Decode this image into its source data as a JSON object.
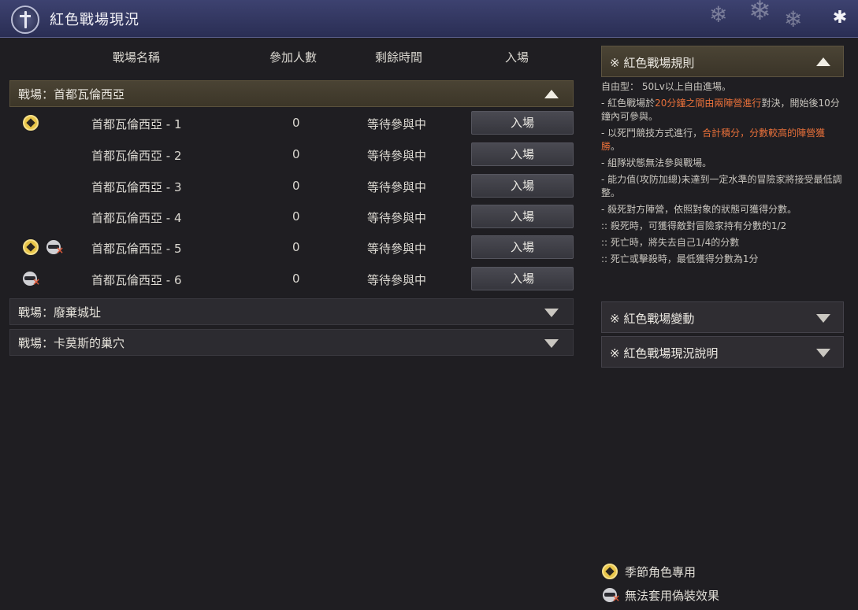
{
  "window": {
    "title": "紅色戰場現況"
  },
  "columns": {
    "name": "戰場名稱",
    "count": "參加人數",
    "time": "剩餘時間",
    "enter": "入場"
  },
  "groups": [
    {
      "label": "戰場：首都瓦倫西亞",
      "expanded": true
    },
    {
      "label": "戰場：廢棄城址",
      "expanded": false
    },
    {
      "label": "戰場：卡莫斯的巢穴",
      "expanded": false
    }
  ],
  "rows": [
    {
      "name": "首都瓦倫西亞 - 1",
      "count": "0",
      "status": "等待參與中",
      "button": "入場",
      "icons": [
        "season-icon"
      ]
    },
    {
      "name": "首都瓦倫西亞 - 2",
      "count": "0",
      "status": "等待參與中",
      "button": "入場",
      "icons": []
    },
    {
      "name": "首都瓦倫西亞 - 3",
      "count": "0",
      "status": "等待參與中",
      "button": "入場",
      "icons": []
    },
    {
      "name": "首都瓦倫西亞 - 4",
      "count": "0",
      "status": "等待參與中",
      "button": "入場",
      "icons": []
    },
    {
      "name": "首都瓦倫西亞 - 5",
      "count": "0",
      "status": "等待參與中",
      "button": "入場",
      "icons": [
        "season-icon",
        "no-disguise-icon"
      ]
    },
    {
      "name": "首都瓦倫西亞 - 6",
      "count": "0",
      "status": "等待參與中",
      "button": "入場",
      "icons": [
        "no-disguise-icon"
      ]
    }
  ],
  "rules": {
    "header": "※ 紅色戰場規則",
    "free_type": "自由型： 50Lv以上自由進場。",
    "line1_pre": "- 紅色戰場於",
    "line1_hl": "20分鐘之間由兩陣營進行",
    "line1_post": "對決，開始後10分鐘內可參與。",
    "line2_pre": "- 以死鬥競技方式進行，",
    "line2_hl": "合計積分，分數較高的陣營獲勝",
    "line2_post": "。",
    "line3": "- 組隊狀態無法參與戰場。",
    "line4": "- 能力值(攻防加總)未達到一定水準的冒險家將接受最低調整。",
    "line5": "- 殺死對方陣營，依照對象的狀態可獲得分數。",
    "line6": ":: 殺死時，可獲得敵對冒險家持有分數的1/2",
    "line7": ":: 死亡時，將失去自己1/4的分數",
    "line8": ":: 死亡或擊殺時，最低獲得分數為1分"
  },
  "rule_sections": [
    {
      "label": "※ 紅色戰場變動",
      "expanded": false
    },
    {
      "label": "※ 紅色戰場現況說明",
      "expanded": false
    }
  ],
  "legend": {
    "season": "季節角色專用",
    "no_disguise": "無法套用偽裝效果"
  },
  "colors": {
    "highlight": "#e8703a",
    "season_icon": "#e9c64a",
    "title_bar": "#3d4270"
  }
}
